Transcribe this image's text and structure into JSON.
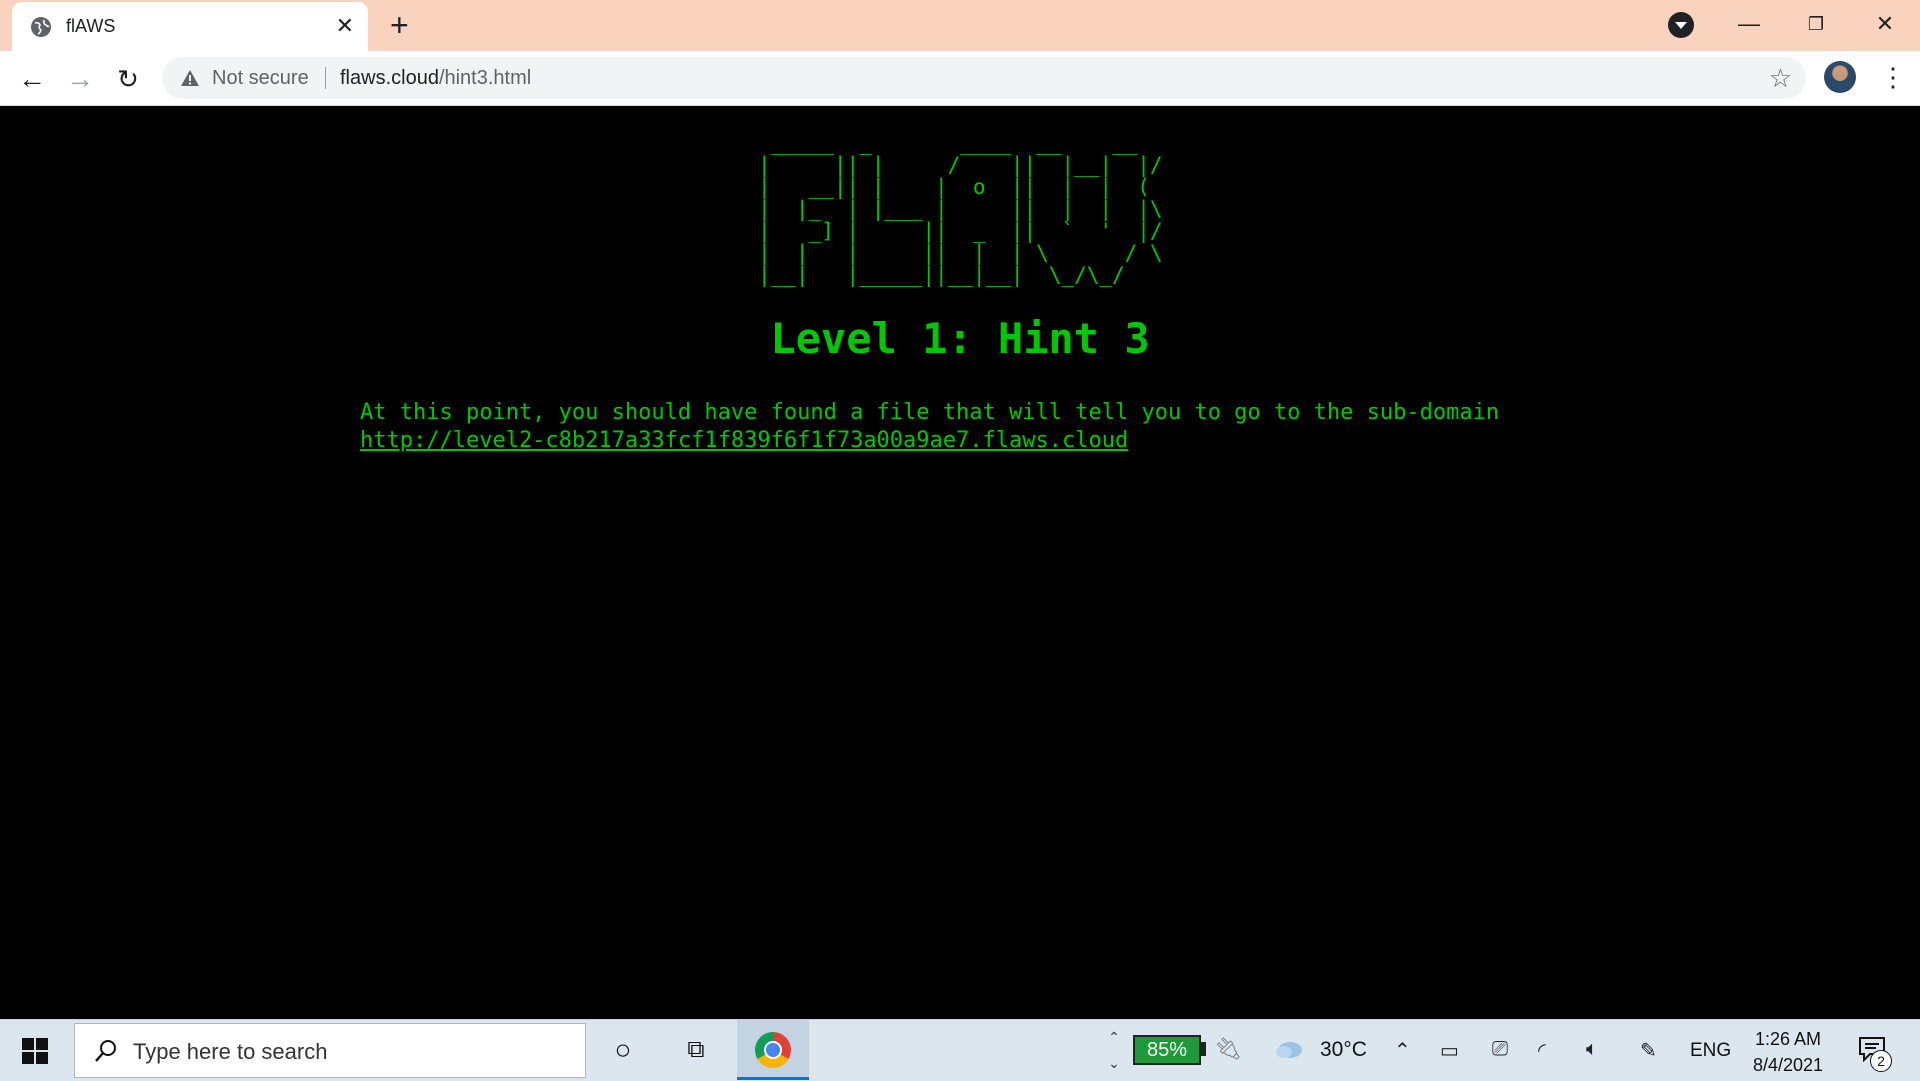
{
  "browser": {
    "tab_title": "flAWS",
    "security_label": "Not secure",
    "url_host": "flaws.cloud",
    "url_path": "/hint3.html"
  },
  "page": {
    "title": "Level 1: Hint 3",
    "hint_text": "At this point, you should have found a file that will tell you to go to the sub-domain",
    "link_text": "http://level2-c8b217a33fcf1f839f6f1f73a00a9ae7.flaws.cloud",
    "logo_lines": [
      " _____  _       ____  __    __  _____",
      "|     || |     /    ||  |__|  |/ ___/",
      "|   __|| |    |  o  ||  |  |  (   \\_ ",
      "|  |_  | |___ |     ||  |  |  |\\__  |",
      "|   _] |     ||  _  ||  `  '  |/  \\ |",
      "|  |   |     ||  |  | \\      / \\    |",
      "|__|   |_____||__|__|  \\_/\\_/   \\___|"
    ],
    "text_color": "#00c800"
  },
  "taskbar": {
    "search_placeholder": "Type here to search",
    "battery": "85%",
    "temperature": "30°C",
    "language": "ENG",
    "time": "1:26 AM",
    "date": "8/4/2021",
    "notification_count": "2"
  }
}
